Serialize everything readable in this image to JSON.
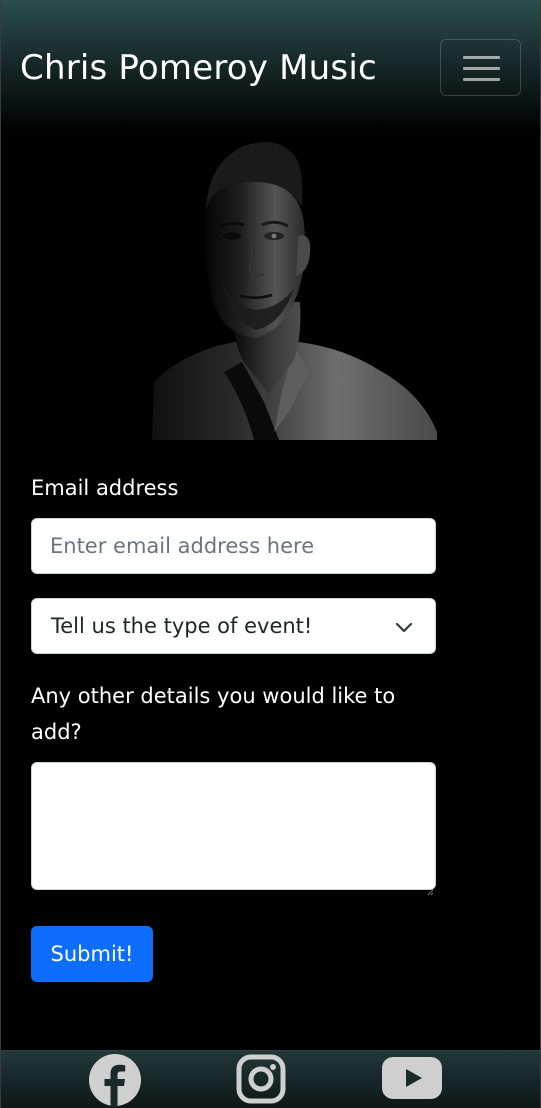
{
  "navbar": {
    "brand": "Chris Pomeroy Music",
    "menu_icon": "hamburger-menu-icon"
  },
  "hero": {
    "image": "portrait-photo"
  },
  "form": {
    "email_label": "Email address",
    "email_placeholder": "Enter email address here",
    "email_value": "",
    "event_select_value": "Tell us the type of event!",
    "details_label": "Any other details you would like to add?",
    "details_value": "",
    "submit_label": "Submit!"
  },
  "footer": {
    "icons": [
      "facebook-icon",
      "instagram-icon",
      "youtube-icon"
    ]
  },
  "colors": {
    "primary": "#0d6efd",
    "navbar_top": "#2b4e4e",
    "background": "#000000",
    "icon": "#c8c8c8"
  }
}
